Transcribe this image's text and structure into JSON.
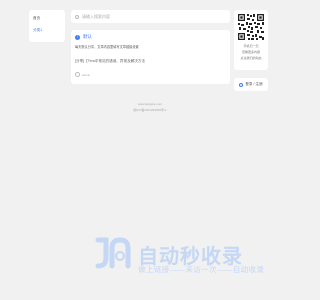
{
  "sidebar": {
    "items": [
      {
        "label": "首页",
        "active": false
      },
      {
        "label": "分类1",
        "active": true
      }
    ]
  },
  "search": {
    "placeholder": "请输入搜索内容"
  },
  "notice": {
    "badge": "!",
    "title": "默认",
    "text": "每天默认分享，文章内容里填写文章链接设置"
  },
  "shared_item": {
    "text": "[分享]【Tera中常见的错误、异常及解决方法"
  },
  "author": {
    "label": "admin"
  },
  "qr": {
    "lines": [
      "手机扫一扫",
      "查看更多内容",
      "关注我们的动态"
    ]
  },
  "login": {
    "label": "登录 / 注册"
  },
  "footer": {
    "lines": [
      "www.tangsite.com",
      "闽ICP备2021064595号-1"
    ]
  },
  "watermark": {
    "title": "自动秒收录",
    "subtitle": "做上链接——来访一次——自动收录"
  },
  "colors": {
    "accent": "#3d7cf5",
    "watermark": "#c4d7f5",
    "background": "#f1f1f1"
  },
  "icons": [
    "search-icon",
    "info-icon",
    "user-icon",
    "qr-code-icon",
    "login-icon",
    "site-logo-icon"
  ]
}
